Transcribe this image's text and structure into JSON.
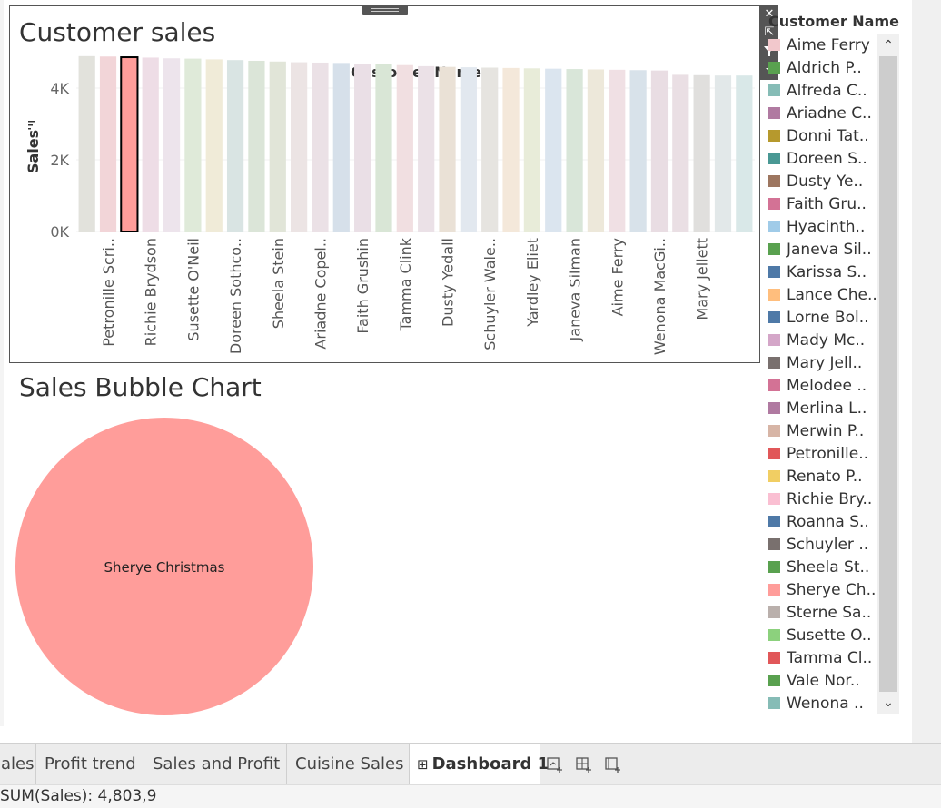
{
  "dashboard": {
    "bar_sheet_title": "Customer sales",
    "bubble_sheet_title": "Sales Bubble Chart"
  },
  "zone_toolbar": {
    "close_icon": "close-icon",
    "popout_icon": "popout-icon",
    "filter_icon": "filter-icon",
    "more_icon": "chevron-down-icon"
  },
  "chart_data": [
    {
      "type": "bar",
      "title": "Customer sales",
      "header": "Customer Name",
      "ylabel": "Sales",
      "ylim": [
        0,
        5000
      ],
      "yticks": [
        0,
        2000,
        4000
      ],
      "ytick_labels": [
        "0K",
        "2K",
        "4K"
      ],
      "categories": [
        "",
        "Petronille Scri..",
        "",
        "Richie Brydson",
        "",
        "Susette O'Neil",
        "",
        "Doreen Sothco..",
        "",
        "Sheela Stein",
        "",
        "Ariadne Copel..",
        "",
        "Faith Grushin",
        "",
        "Tamma Clink",
        "",
        "Dusty Yedall",
        "",
        "Schuyler Wale..",
        "",
        "Yardley Eliet",
        "",
        "Janeva Silman",
        "",
        "Aime Ferry",
        "",
        "Wenona MacGi..",
        "",
        "Mary Jellett",
        ""
      ],
      "values": [
        4890,
        4880,
        4860,
        4850,
        4830,
        4820,
        4800,
        4780,
        4760,
        4740,
        4720,
        4710,
        4700,
        4680,
        4660,
        4640,
        4610,
        4590,
        4580,
        4570,
        4560,
        4550,
        4540,
        4530,
        4520,
        4510,
        4500,
        4490,
        4370,
        4360,
        4350,
        4350
      ],
      "colors": [
        "#e2e2dc",
        "#f2d5d8",
        "#ff9d9a",
        "#eedde6",
        "#ede4ec",
        "#dfead9",
        "#f0ebd8",
        "#d9e4e3",
        "#dbe5d8",
        "#e1e5d8",
        "#ece4e4",
        "#ebe1e6",
        "#d6e0ea",
        "#eadfe6",
        "#d9e6d6",
        "#f1dfe1",
        "#ebe1e7",
        "#eae1d6",
        "#e2e8ef",
        "#e6e4e0",
        "#f4e8da",
        "#e8ecd9",
        "#dbe5ef",
        "#d9e6d9",
        "#ede8da",
        "#f0e0e4",
        "#d8e2ea",
        "#e9dde3",
        "#eadfe4",
        "#e0dfdd",
        "#e2e8e9",
        "#d9e8e8"
      ],
      "highlighted_index": 2
    },
    {
      "type": "bubble",
      "title": "Sales Bubble Chart",
      "bubbles": [
        {
          "label": "Sherye Christmas",
          "value": 4803.9,
          "color": "#ff9d9a"
        }
      ]
    }
  ],
  "legend": {
    "title": "Customer Name",
    "items": [
      {
        "label": "Aime Ferry",
        "color": "#f2c8cc"
      },
      {
        "label": "Aldrich P..",
        "color": "#59a14f"
      },
      {
        "label": "Alfreda C..",
        "color": "#86bcb6"
      },
      {
        "label": "Ariadne C..",
        "color": "#b07aa1"
      },
      {
        "label": "Donni Tat..",
        "color": "#b6992d"
      },
      {
        "label": "Doreen S..",
        "color": "#499894"
      },
      {
        "label": "Dusty Ye..",
        "color": "#9d7660"
      },
      {
        "label": "Faith Gru..",
        "color": "#d37295"
      },
      {
        "label": "Hyacinth..",
        "color": "#a0cbe8"
      },
      {
        "label": "Janeva Sil..",
        "color": "#59a14f"
      },
      {
        "label": "Karissa S..",
        "color": "#4e79a7"
      },
      {
        "label": "Lance Che..",
        "color": "#ffbe7d"
      },
      {
        "label": "Lorne Bol..",
        "color": "#4e79a7"
      },
      {
        "label": "Mady Mc..",
        "color": "#d4a6c8"
      },
      {
        "label": "Mary Jell..",
        "color": "#79706e"
      },
      {
        "label": "Melodee ..",
        "color": "#d37295"
      },
      {
        "label": "Merlina L..",
        "color": "#b07aa1"
      },
      {
        "label": "Merwin P..",
        "color": "#d7b5a6"
      },
      {
        "label": "Petronille..",
        "color": "#e15759"
      },
      {
        "label": "Renato P..",
        "color": "#f1ce63"
      },
      {
        "label": "Richie Bry..",
        "color": "#fabfd2"
      },
      {
        "label": "Roanna S..",
        "color": "#4e79a7"
      },
      {
        "label": "Schuyler ..",
        "color": "#79706e"
      },
      {
        "label": "Sheela St..",
        "color": "#59a14f"
      },
      {
        "label": "Sherye Ch..",
        "color": "#ff9d9a"
      },
      {
        "label": "Sterne Sa..",
        "color": "#bab0ac"
      },
      {
        "label": "Susette O..",
        "color": "#8cd17d"
      },
      {
        "label": "Tamma Cl..",
        "color": "#e15759"
      },
      {
        "label": "Vale Nor..",
        "color": "#59a14f"
      },
      {
        "label": "Wenona ..",
        "color": "#86bcb6"
      }
    ]
  },
  "tabs": [
    {
      "label": "ales",
      "active": false
    },
    {
      "label": "Profit trend",
      "active": false
    },
    {
      "label": "Sales and Profit",
      "active": false
    },
    {
      "label": "Cuisine Sales",
      "active": false
    },
    {
      "label": "Dashboard 1",
      "active": true
    }
  ],
  "tab_icons": [
    "new-worksheet-icon",
    "new-dashboard-icon",
    "new-story-icon"
  ],
  "status": {
    "text": "SUM(Sales): 4,803,9"
  }
}
